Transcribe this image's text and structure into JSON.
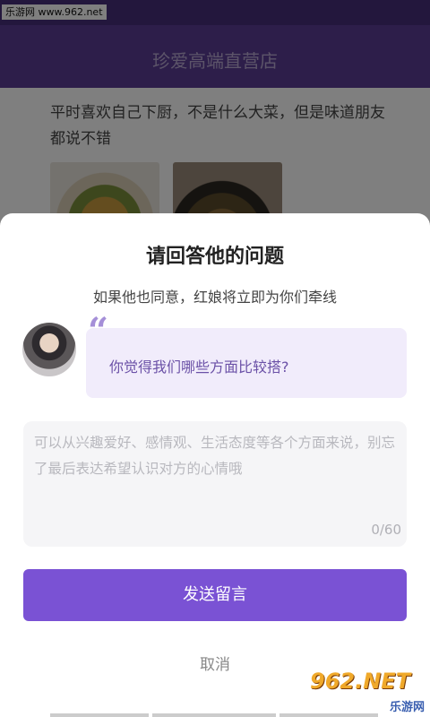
{
  "watermark": {
    "site": "乐游网 www.962.net",
    "logo": "962.NET",
    "logo_sub": "乐游网"
  },
  "header": {
    "title": "珍爱高端直营店"
  },
  "post": {
    "text": "平时喜欢自己下厨，不是什么大菜，但是味道朋友都说不错"
  },
  "dialog": {
    "title": "请回答他的问题",
    "subtitle": "如果他也同意，红娘将立即为你们牵线",
    "quote_mark": "“",
    "question": "你觉得我们哪些方面比较搭?",
    "input": {
      "value": "",
      "placeholder": "可以从兴趣爱好、感情观、生活态度等各个方面来说，别忘了最后表达希望认识对方的心情哦",
      "counter": "0/60"
    },
    "send_label": "发送留言",
    "cancel_label": "取消"
  },
  "colors": {
    "accent": "#7a52d4",
    "header": "#5b3d94",
    "question_text": "#6b51a7"
  }
}
